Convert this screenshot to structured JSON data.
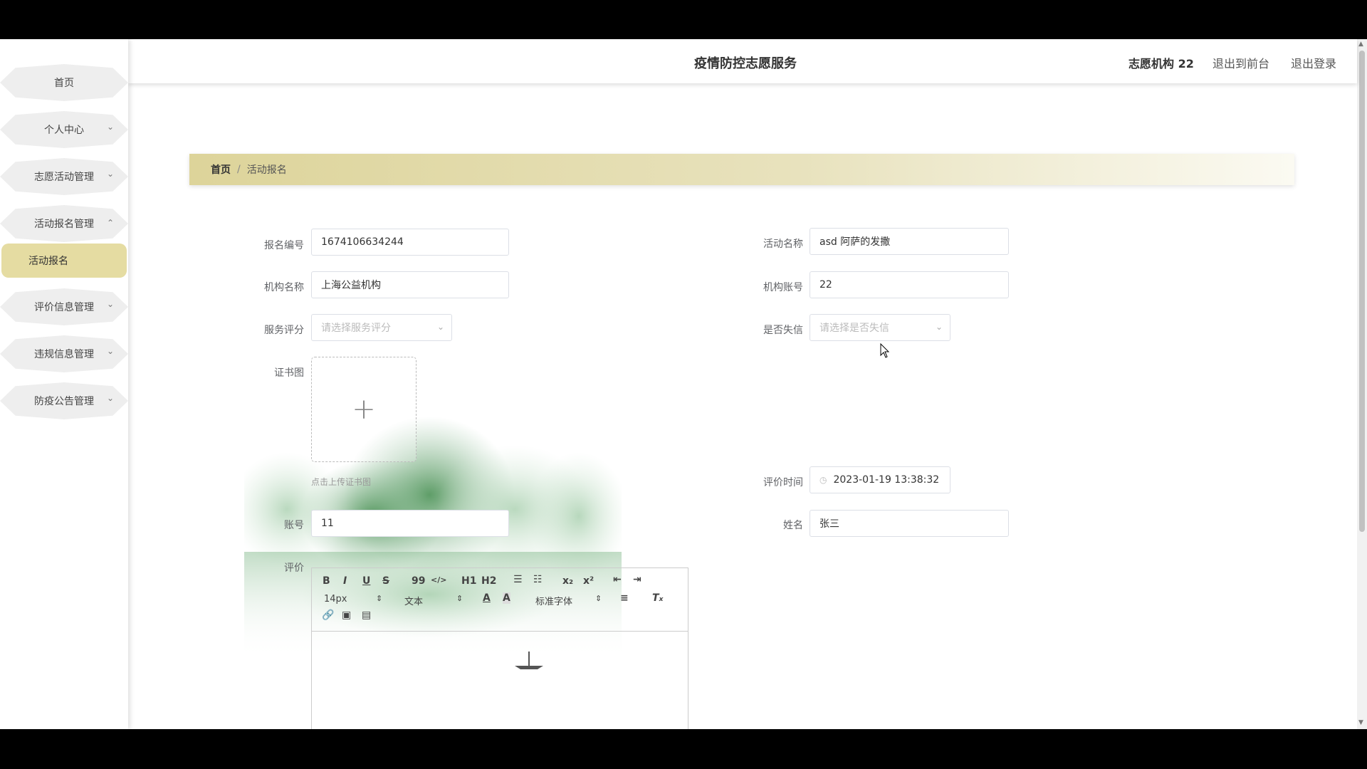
{
  "header": {
    "title": "疫情防控志愿服务",
    "user": "志愿机构 22",
    "back_to_front": "退出到前台",
    "logout": "退出登录"
  },
  "sidebar": {
    "items": [
      {
        "label": "首页"
      },
      {
        "label": "个人中心"
      },
      {
        "label": "志愿活动管理"
      },
      {
        "label": "活动报名管理"
      },
      {
        "label": "评价信息管理"
      },
      {
        "label": "违规信息管理"
      },
      {
        "label": "防疫公告管理"
      }
    ],
    "active_sub": "活动报名"
  },
  "breadcrumb": {
    "home": "首页",
    "separator": "/",
    "current": "活动报名"
  },
  "form": {
    "signup_no_label": "报名编号",
    "signup_no": "1674106634244",
    "activity_name_label": "活动名称",
    "activity_name": "asd 阿萨的发撒",
    "org_name_label": "机构名称",
    "org_name": "上海公益机构",
    "org_account_label": "机构账号",
    "org_account": "22",
    "service_score_label": "服务评分",
    "service_score_placeholder": "请选择服务评分",
    "dishonest_label": "是否失信",
    "dishonest_placeholder": "请选择是否失信",
    "certificate_label": "证书图",
    "upload_tip": "点击上传证书图",
    "review_time_label": "评价时间",
    "review_time": "2023-01-19 13:38:32",
    "account_label": "账号",
    "account": "11",
    "name_label": "姓名",
    "name": "张三",
    "review_label": "评价"
  },
  "editor": {
    "bold": "B",
    "italic": "I",
    "underline": "U",
    "strike": "S",
    "quote": "99",
    "code": "</>",
    "h1": "H1",
    "h2": "H2",
    "subscript": "x₂",
    "superscript": "x²",
    "font_size": "14px",
    "text_style": "文本",
    "font_family": "标准字体"
  },
  "colors": {
    "accent": "#e5dca2",
    "breadcrumb_start": "#ddd49a"
  }
}
